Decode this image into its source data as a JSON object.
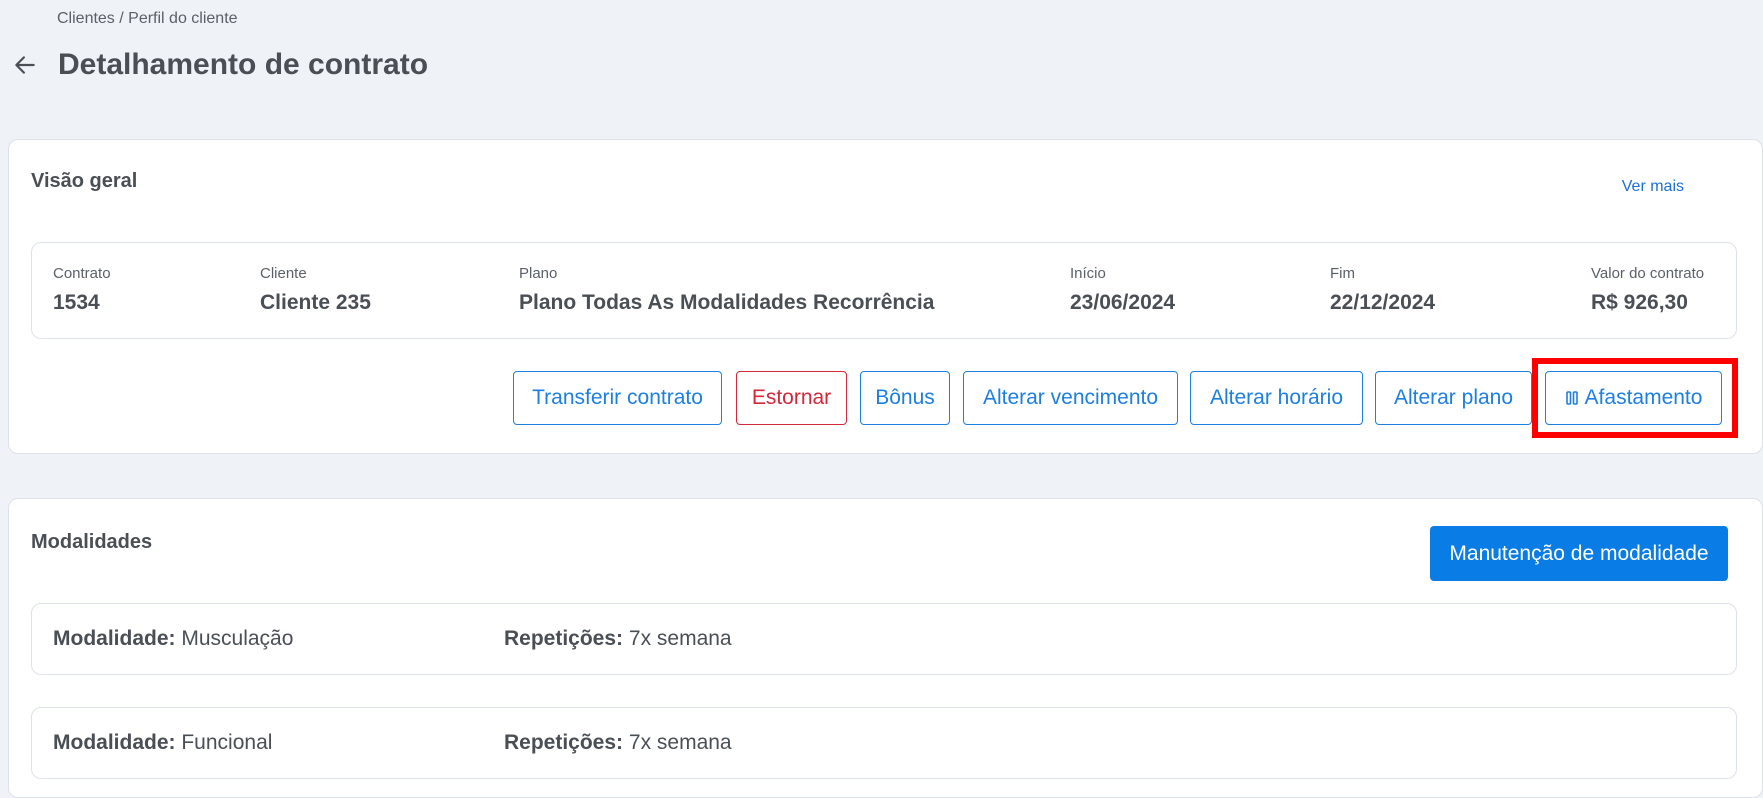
{
  "breadcrumb": "Clientes / Perfil do cliente",
  "page_title": "Detalhamento de contrato",
  "overview": {
    "title": "Visão geral",
    "ver_mais": "Ver mais",
    "fields": [
      {
        "label": "Contrato",
        "value": "1534"
      },
      {
        "label": "Cliente",
        "value": "Cliente 235"
      },
      {
        "label": "Plano",
        "value": "Plano Todas As Modalidades Recorrência"
      },
      {
        "label": "Início",
        "value": "23/06/2024"
      },
      {
        "label": "Fim",
        "value": "22/12/2024"
      },
      {
        "label": "Valor do contrato",
        "value": "R$ 926,30"
      }
    ],
    "actions": {
      "transferir": "Transferir contrato",
      "estornar": "Estornar",
      "bonus": "Bônus",
      "alterar_vencimento": "Alterar vencimento",
      "alterar_horario": "Alterar horário",
      "alterar_plano": "Alterar plano",
      "afastamento": "Afastamento"
    }
  },
  "modalities": {
    "title": "Modalidades",
    "manutencao": "Manutenção de modalidade",
    "modalidade_label": "Modalidade:",
    "repeticoes_label": "Repetições:",
    "rows": [
      {
        "modalidade": "Musculação",
        "repeticoes": "7x semana"
      },
      {
        "modalidade": "Funcional",
        "repeticoes": "7x semana"
      }
    ]
  },
  "colors": {
    "accent": "#1d7fe0",
    "primary": "#0a7ce6",
    "danger": "#d3273a",
    "highlight": "#ff0000"
  }
}
